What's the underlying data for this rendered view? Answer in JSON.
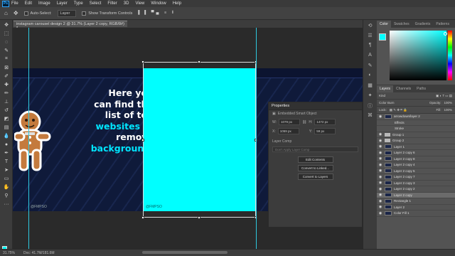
{
  "menu": [
    "File",
    "Edit",
    "Image",
    "Layer",
    "Type",
    "Select",
    "Filter",
    "3D",
    "View",
    "Window",
    "Help"
  ],
  "options": {
    "auto_select_label": "Auto-Select:",
    "auto_select_value": "Layer",
    "transform_label": "Show Transform Controls"
  },
  "document": {
    "tab_title": "instagram carousel design 2 @ 31.7% (Layer 2 copy, RGB/8#) *"
  },
  "canvas": {
    "line1": "Here you",
    "line2": "can find the",
    "line3": "list of top",
    "line4": "websites",
    "line4b": "to",
    "line5": "remove",
    "line6": "background.",
    "handle": "@FMPSO",
    "handle2": "@FMPSO"
  },
  "properties": {
    "title": "Properties",
    "type": "Embedded Smart Object",
    "w_label": "W:",
    "w_value": "1079 px",
    "h_label": "H:",
    "h_value": "1472 px",
    "x_label": "X:",
    "x_value": "1059 px",
    "y_label": "Y:",
    "y_value": "59 px",
    "comp_label": "Layer Comp",
    "comp_placeholder": "Don't Apply Layer Comp",
    "btn_edit": "Edit Contents",
    "btn_linked": "Convert to Linked...",
    "btn_layers": "Convert to Layers"
  },
  "status": {
    "zoom": "31.75%",
    "doc": "Doc: 41.7M/181.6M"
  },
  "color_panel": {
    "tabs": [
      "Color",
      "Swatches",
      "Gradients",
      "Patterns"
    ],
    "fg": "#00ffff"
  },
  "layers_panel": {
    "tabs": [
      "Layers",
      "Channels",
      "Paths"
    ],
    "kind": "Kind",
    "blend": "Color Burn",
    "opacity_label": "Opacity:",
    "opacity": "100%",
    "lock_label": "Lock:",
    "fill_label": "Fill:",
    "fill": "100%",
    "layers": [
      {
        "name": "arrowdown/layer 2",
        "kind": "layer",
        "selected": false
      },
      {
        "name": "Effects",
        "kind": "fx",
        "selected": false
      },
      {
        "name": "Stroke",
        "kind": "fx",
        "selected": false
      },
      {
        "name": "Group 1",
        "kind": "folder",
        "selected": false
      },
      {
        "name": "Group 2",
        "kind": "folder",
        "selected": false
      },
      {
        "name": "Layer 1",
        "kind": "layer",
        "selected": false
      },
      {
        "name": "Layer 2 copy 6",
        "kind": "layer",
        "selected": false
      },
      {
        "name": "Layer 2 copy 8",
        "kind": "layer",
        "selected": false
      },
      {
        "name": "Layer 2 copy 4",
        "kind": "layer",
        "selected": false
      },
      {
        "name": "Layer 2 copy 5",
        "kind": "layer",
        "selected": false
      },
      {
        "name": "Layer 2 copy 7",
        "kind": "layer",
        "selected": false
      },
      {
        "name": "Layer 2 copy 3",
        "kind": "layer",
        "selected": false
      },
      {
        "name": "Layer 2 copy 2",
        "kind": "layer",
        "selected": false
      },
      {
        "name": "Layer 2 copy",
        "kind": "layer",
        "selected": true
      },
      {
        "name": "Rectangle 1",
        "kind": "layer",
        "selected": false
      },
      {
        "name": "Layer 2",
        "kind": "layer",
        "selected": false
      },
      {
        "name": "Color Fill 1",
        "kind": "layer",
        "selected": false
      }
    ]
  }
}
